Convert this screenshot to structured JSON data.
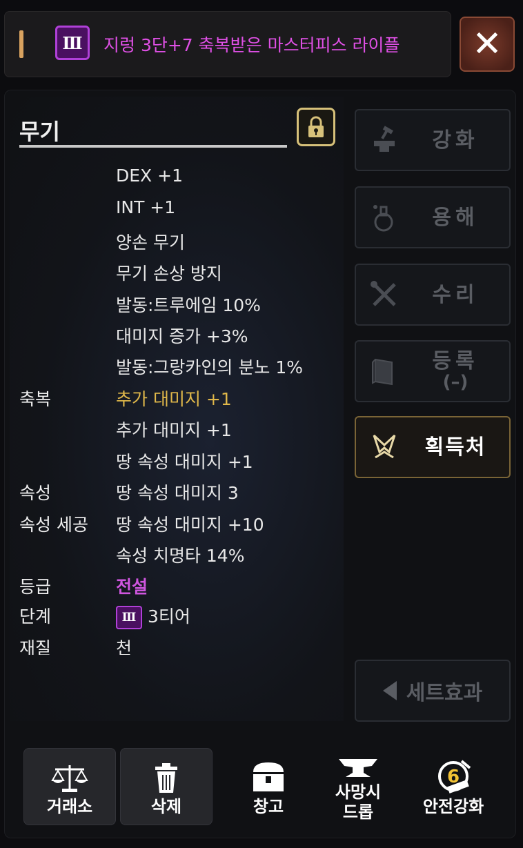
{
  "title_bar": {
    "tier_numeral": "Ⅲ",
    "item_name": "지렁 3단+7 축복받은 마스터피스 라이플",
    "close_label": "✕"
  },
  "panel": {
    "category": "무기",
    "stats": [
      {
        "label": "",
        "value": "DEX +1"
      },
      {
        "label": "",
        "value": "INT +1"
      },
      {
        "label": "",
        "value": "양손 무기"
      },
      {
        "label": "",
        "value": "무기 손상 방지"
      },
      {
        "label": "",
        "value": "발동:트루에임 10%"
      },
      {
        "label": "",
        "value": "대미지 증가 +3%"
      },
      {
        "label": "",
        "value": "발동:그랑카인의 분노 1%"
      },
      {
        "label": "축복",
        "value": "추가 대미지 +1"
      },
      {
        "label": "",
        "value": "추가 대미지 +1"
      },
      {
        "label": "",
        "value": "땅 속성 대미지 +1"
      },
      {
        "label": "속성",
        "value": "땅 속성 대미지  3"
      },
      {
        "label": "속성 세공",
        "value": "땅 속성 대미지 +10"
      },
      {
        "label": "",
        "value": "속성 치명타 14%"
      },
      {
        "label": "등급",
        "value": "전설"
      },
      {
        "label": "단계",
        "value": "3티어"
      },
      {
        "label": "재질",
        "value": "천"
      }
    ],
    "tier_badge_numeral": "Ⅲ"
  },
  "side_buttons": {
    "enhance": "강화",
    "dissolve": "용해",
    "repair": "수리",
    "register": "등록",
    "register_sub": "(–)",
    "source": "획득처",
    "set_effect": "세트효과"
  },
  "bottom_bar": {
    "exchange": "거래소",
    "delete": "삭제",
    "storage": "창고",
    "death_drop_1": "사망시",
    "death_drop_2": "드롭",
    "safe_enhance": "안전강화",
    "safe_enhance_num": "6"
  },
  "colors": {
    "accent_gold": "#e0b84a",
    "tier_purple": "#b040d8",
    "title_magenta": "#e050e6"
  }
}
